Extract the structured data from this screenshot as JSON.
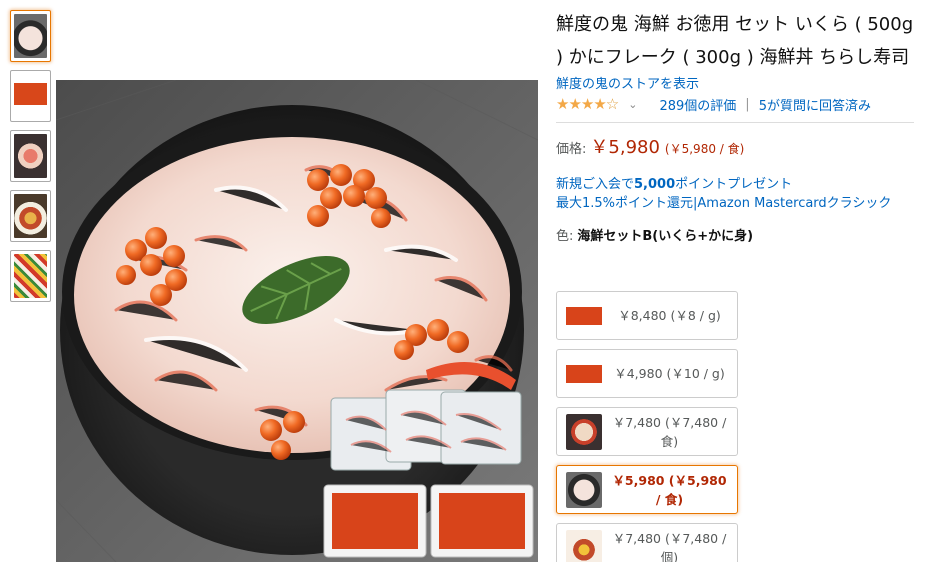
{
  "product": {
    "title": "鮮度の鬼 海鮮 お徳用 セット いくら ( 500g ) かにフレーク ( 300g ) 海鮮丼 ちらし寿司",
    "store_link": "鮮度の鬼のストアを表示",
    "rating": {
      "stars_filled": "★★★★",
      "stars_empty": "☆",
      "caret": "⌄",
      "count_label": "289個の評価",
      "separator": "|",
      "qa_label": "5が質問に回答済み"
    },
    "price": {
      "label": "価格:",
      "value": "￥5,980",
      "unit": "(￥5,980 / 食)"
    },
    "promo": {
      "line1_prefix": "新規ご入会で",
      "line1_bold": "5,000",
      "line1_suffix": "ポイントプレゼント",
      "line2": "最大1.5%ポイント還元|Amazon Mastercardクラシック"
    },
    "color": {
      "label": "色:",
      "value": "海鮮セットB(いくら+かに身)"
    }
  },
  "thumbnails": [
    {
      "icon": "crab-ikura-bowl-thumb"
    },
    {
      "icon": "ikura-tray-thumb"
    },
    {
      "icon": "sashimi-bowl-thumb"
    },
    {
      "icon": "seafood-bowl-thumb"
    },
    {
      "icon": "chirashi-thumb"
    }
  ],
  "variants": [
    {
      "line1": "￥8,480 (￥8 / g)",
      "line2": "",
      "selected": false
    },
    {
      "line1": "￥4,980 (￥10 / g)",
      "line2": "",
      "selected": false
    },
    {
      "line1": "￥7,480 (￥7,480 /",
      "line2": "食)",
      "selected": false
    },
    {
      "line1": "￥5,980 (￥5,980",
      "line2": "/ 食)",
      "selected": true
    },
    {
      "line1": "￥7,480 (￥7,480 /",
      "line2": "個)",
      "selected": false
    }
  ],
  "colors": {
    "link": "#0066c0",
    "price": "#b12704",
    "star": "#f3a847",
    "selected_border": "#e77600"
  }
}
